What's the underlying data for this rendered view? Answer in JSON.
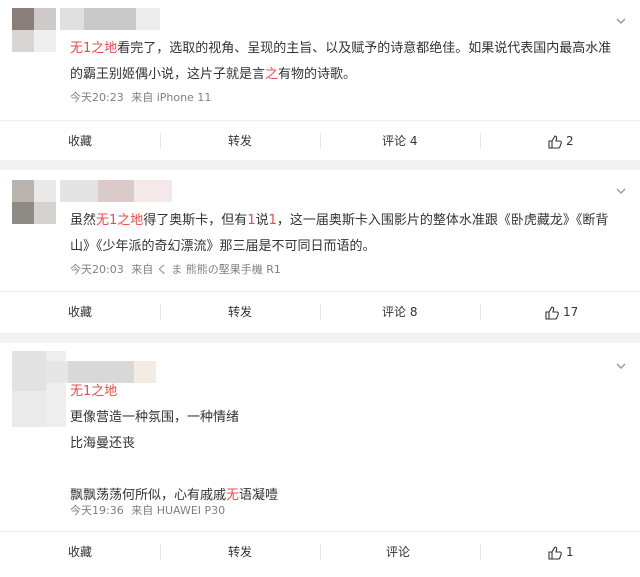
{
  "posts": [
    {
      "mention": "无1之地",
      "body_parts": [
        "看完了，选取的视角、呈现的主旨、以及赋予的诗意都绝佳。如果说代表国内最高水准的霸王别姬偶小说，这片子就是言",
        "之",
        "有物的诗歌。"
      ],
      "time": "今天20:23",
      "source": "来自 iPhone 11",
      "actions": {
        "collect": "收藏",
        "share": "转发",
        "comment": "评论 4",
        "like": "2"
      }
    },
    {
      "body_prefix": "虽然",
      "mention": "无1之地",
      "body_parts": [
        "得了奥斯卡，但有",
        "1",
        "说",
        "1",
        "，这一届奥斯卡入围影片的整体水准跟《卧虎藏龙》《断背山》《少年派的奇幻漂流》那三届是不可同日而语的。"
      ],
      "time": "今天20:03",
      "source": "来自 く ま 熊熊の堅果手機 R1",
      "actions": {
        "collect": "收藏",
        "share": "转发",
        "comment": "评论 8",
        "like": "17"
      }
    },
    {
      "mention": "无1之地",
      "lines": [
        "更像营造一种氛围，一种情绪",
        "比海曼还丧"
      ],
      "last_line_parts": [
        "飘飘荡荡何所似，心有戚戚",
        "无",
        "语凝噎"
      ],
      "time": "今天19:36",
      "source": "来自 HUAWEI P30",
      "actions": {
        "collect": "收藏",
        "share": "转发",
        "comment": "评论",
        "like": "1"
      }
    }
  ],
  "colors": {
    "mention": "#eb4b4b",
    "meta": "#808080",
    "divider": "#f2f2f2"
  }
}
